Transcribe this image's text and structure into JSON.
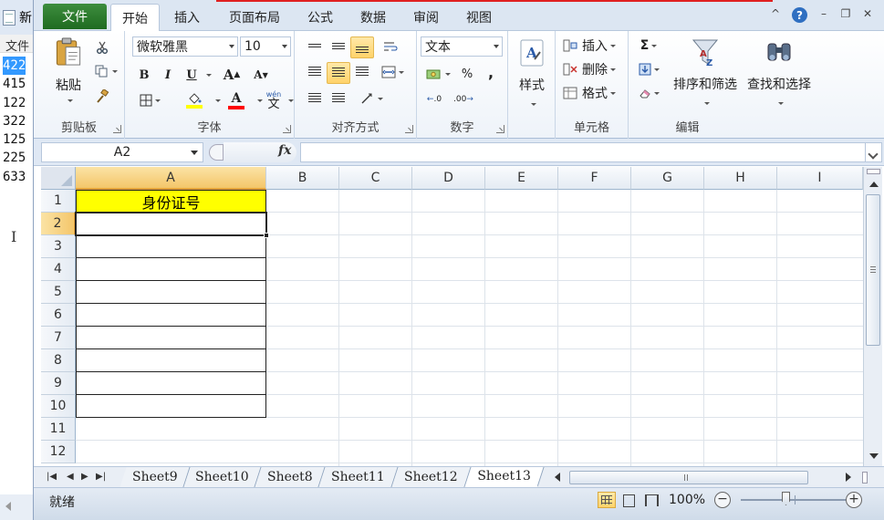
{
  "notepad": {
    "title": "新",
    "menu": "文件",
    "lines": [
      "422",
      "415",
      "122",
      "322",
      "125",
      "225",
      "633"
    ]
  },
  "ribbon_tabs": {
    "file": "文件",
    "tabs": [
      "开始",
      "插入",
      "页面布局",
      "公式",
      "数据",
      "审阅",
      "视图"
    ],
    "active": "开始"
  },
  "window_controls": [
    "^",
    "?",
    "–",
    "❐",
    "✕"
  ],
  "clipboard": {
    "paste": "粘贴",
    "label": "剪贴板"
  },
  "font": {
    "name": "微软雅黑",
    "size": "10",
    "bold": "B",
    "italic": "I",
    "underline": "U",
    "grow": "A",
    "shrink": "A",
    "fill_color": "#ffff00",
    "font_color": "#ff0000",
    "font_letter": "A",
    "wen": "wén",
    "wen_char": "文",
    "label": "字体"
  },
  "alignment": {
    "label": "对齐方式"
  },
  "number": {
    "format": "文本",
    "percent": "%",
    "comma": ",",
    "inc_decimal": ".0",
    "dec_decimal": ".00",
    "label": "数字"
  },
  "styles": {
    "label": "样式"
  },
  "cells": {
    "insert": "插入",
    "delete": "删除",
    "format": "格式",
    "label": "单元格"
  },
  "editing": {
    "sigma": "Σ",
    "sort": "排序和筛选",
    "find": "查找和选择",
    "label": "编辑"
  },
  "formula_bar": {
    "name_box": "A2",
    "fx": "fx",
    "value": ""
  },
  "sheet": {
    "columns": [
      "A",
      "B",
      "C",
      "D",
      "E",
      "F",
      "G",
      "H",
      "I"
    ],
    "rows": [
      "1",
      "2",
      "3",
      "4",
      "5",
      "6",
      "7",
      "8",
      "9",
      "10",
      "11",
      "12"
    ],
    "active_cell": "A2",
    "a1_value": "身份证号",
    "a1_fill": "#ffff00"
  },
  "sheet_tabs": {
    "tabs": [
      "Sheet9",
      "Sheet10",
      "Sheet8",
      "Sheet11",
      "Sheet12",
      "Sheet13"
    ],
    "active": "Sheet13"
  },
  "status": {
    "ready": "就绪",
    "zoom": "100%",
    "zoom_minus": "−",
    "zoom_plus": "+"
  }
}
